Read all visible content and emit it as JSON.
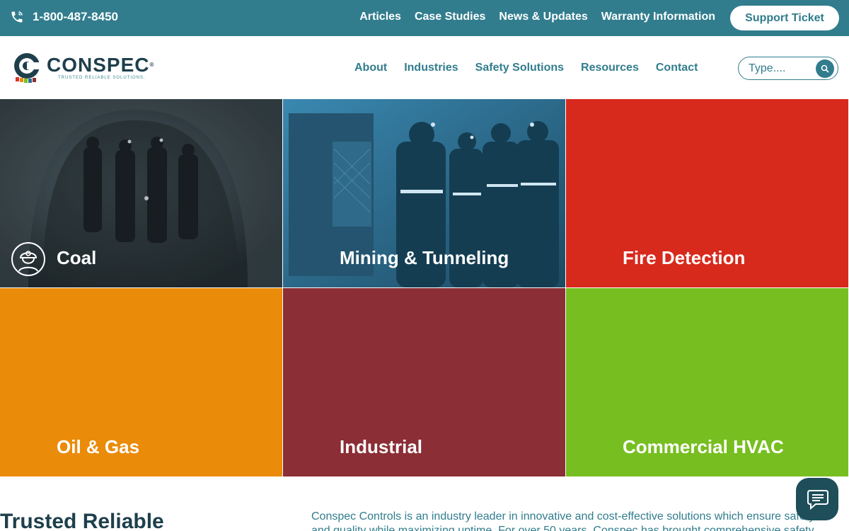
{
  "topbar": {
    "phone": "1-800-487-8450",
    "links": [
      "Articles",
      "Case Studies",
      "News & Updates",
      "Warranty Information"
    ],
    "support_button": "Support Ticket"
  },
  "header": {
    "logo_word": "CONSPEC",
    "logo_tagline": "TRUSTED RELIABLE SOLUTIONS.",
    "nav": [
      "About",
      "Industries",
      "Safety Solutions",
      "Resources",
      "Contact"
    ],
    "search_placeholder": "Type...."
  },
  "tiles": [
    {
      "label": "Coal",
      "color": "#2e3a40"
    },
    {
      "label": "Mining & Tunneling",
      "color": "#2a6f92"
    },
    {
      "label": "Fire Detection",
      "color": "#d8291d"
    },
    {
      "label": "Oil & Gas",
      "color": "#ea8b09"
    },
    {
      "label": "Industrial",
      "color": "#8b2e36"
    },
    {
      "label": "Commercial HVAC",
      "color": "#77be20"
    }
  ],
  "intro": {
    "heading": "Trusted Reliable",
    "text": "Conspec Controls is an industry leader in innovative and cost-effective solutions which ensure safety and quality while maximizing uptime. For over 50 years, Conspec has brought comprehensive safety and"
  },
  "colors": {
    "brand": "#317d8e",
    "dark": "#1e3f4c"
  },
  "icons": {
    "phone": "phone-icon",
    "search": "search-icon",
    "chat": "chat-icon",
    "miner": "miner-helmet-icon"
  }
}
